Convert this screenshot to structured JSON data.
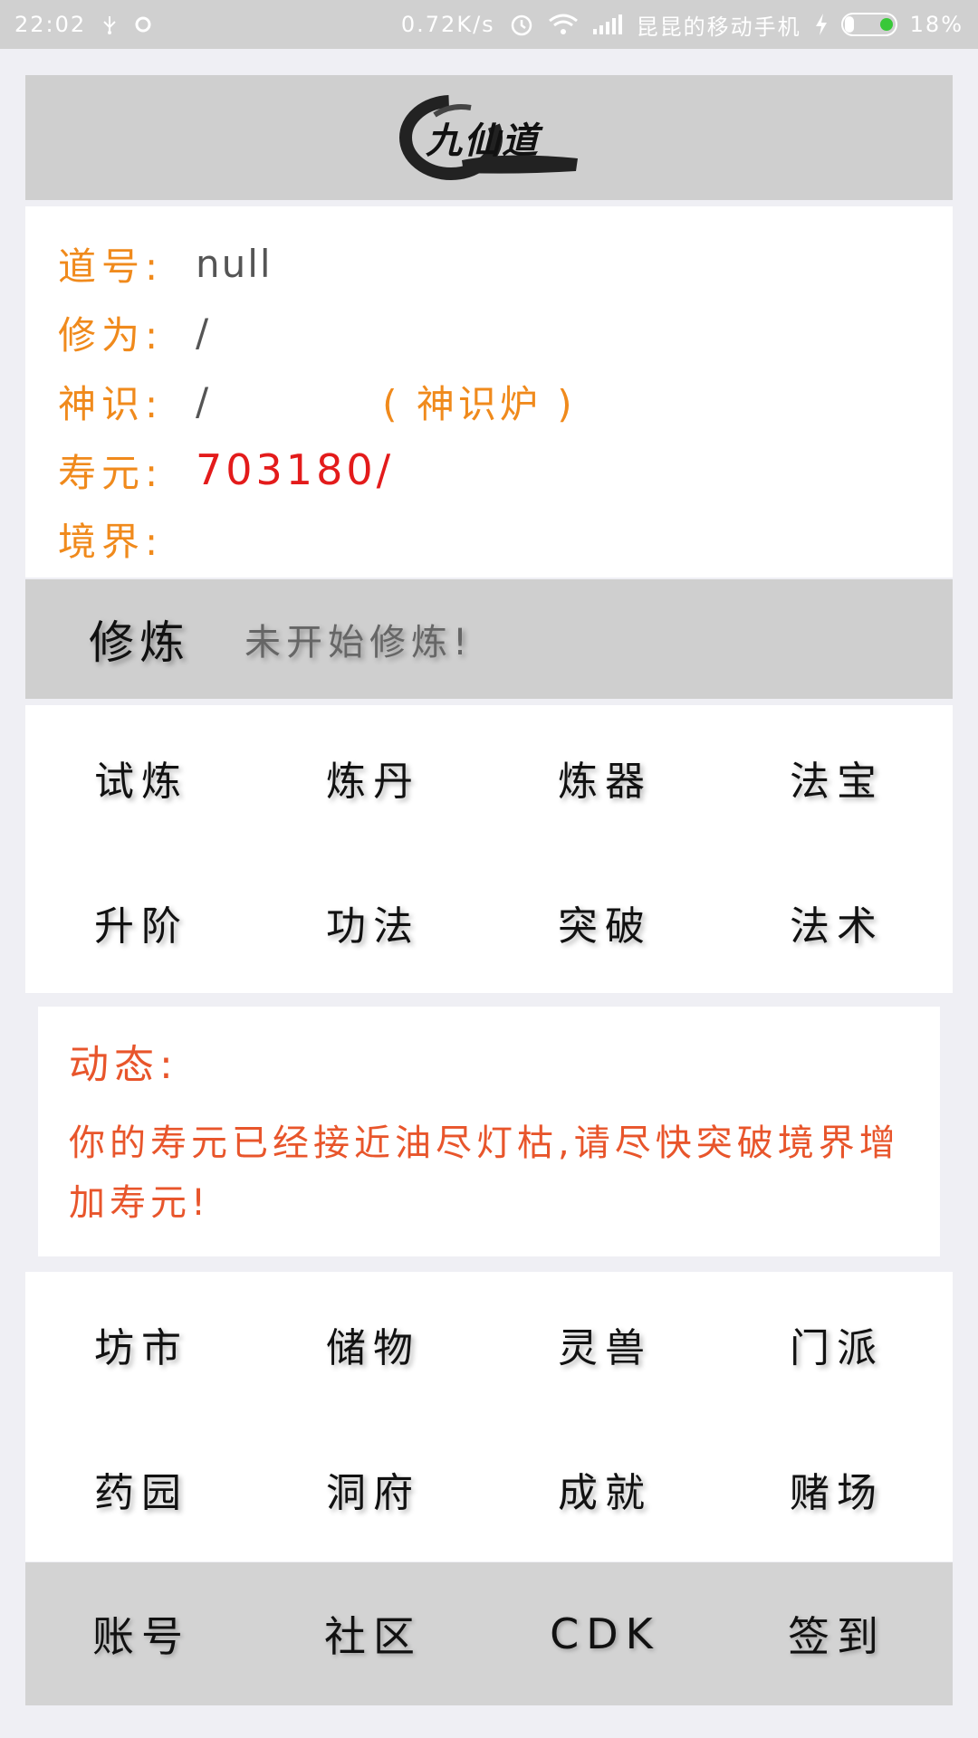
{
  "status_bar": {
    "time": "22:02",
    "net_speed": "0.72K/s",
    "carrier": "昆昆的移动手机",
    "battery": "18%",
    "battery_level": 0.18,
    "icons": [
      "usb-icon",
      "notification-dot-icon",
      "alarm-icon",
      "wifi-icon",
      "signal-icon",
      "charging-icon"
    ]
  },
  "header": {
    "logo_text": "九仙道"
  },
  "profile": {
    "name_label": "道号:",
    "name_value": "null",
    "cultivation_label": "修为:",
    "cultivation_value": "/",
    "spirit_label": "神识:",
    "spirit_value": "/",
    "spirit_furnace_link": "( 神识炉 )",
    "lifespan_label": "寿元:",
    "lifespan_value": "703180/",
    "realm_label": "境界:",
    "realm_value": ""
  },
  "cultivate": {
    "title": "修炼",
    "status": "未开始修炼!"
  },
  "menu_top": [
    "试炼",
    "炼丹",
    "炼器",
    "法宝",
    "升阶",
    "功法",
    "突破",
    "法术"
  ],
  "news": {
    "title": "动态:",
    "body": "你的寿元已经接近油尽灯枯,请尽快突破境界增加寿元!"
  },
  "menu_bottom": [
    "坊市",
    "储物",
    "灵兽",
    "门派",
    "药园",
    "洞府",
    "成就",
    "赌场"
  ],
  "bottom_bar": [
    "账号",
    "社区",
    "CDK",
    "签到"
  ],
  "colors": {
    "label_orange": "#f08a1c",
    "lifespan_red": "#e31b1b",
    "news_orange": "#e8552b",
    "panel_gray": "#cfcfcf"
  }
}
